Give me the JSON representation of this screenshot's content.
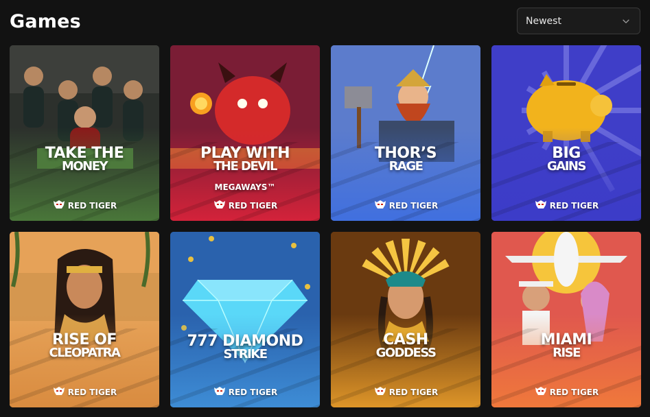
{
  "header": {
    "title": "Games",
    "sort": {
      "selected": "Newest"
    }
  },
  "games": [
    {
      "line1": "Take the",
      "line2": "Money",
      "line3": "",
      "provider": "RED TIGER",
      "bg_top": "#3a3f3a",
      "bg_bottom": "#4b7a3a",
      "accent": "#c9a67a",
      "icon": "gangsters-icon"
    },
    {
      "line1": "Play with",
      "line2": "the Devil",
      "line3": "Megaways™",
      "provider": "RED TIGER",
      "bg_top": "#6a1a2a",
      "bg_bottom": "#d8233a",
      "accent": "#e23a2a",
      "icon": "devil-icon"
    },
    {
      "line1": "Thor’s",
      "line2": "Rage",
      "line3": "",
      "provider": "RED TIGER",
      "bg_top": "#6f8fd0",
      "bg_bottom": "#3f6fe0",
      "accent": "#c44a24",
      "icon": "thor-icon"
    },
    {
      "line1": "Big",
      "line2": "Gains",
      "line3": "",
      "provider": "RED TIGER",
      "bg_top": "#4a47d6",
      "bg_bottom": "#3c3cc8",
      "accent": "#f2b31c",
      "icon": "piggy-bank-icon"
    },
    {
      "line1": "Rise of",
      "line2": "Cleopatra",
      "line3": "",
      "provider": "RED TIGER",
      "bg_top": "#e8a25a",
      "bg_bottom": "#d88a3e",
      "accent": "#5a3a22",
      "icon": "cleopatra-icon"
    },
    {
      "line1": "777 Diamond",
      "line2": "Strike",
      "line3": "",
      "provider": "RED TIGER",
      "bg_top": "#2a5aa0",
      "bg_bottom": "#3f8fd8",
      "accent": "#5ad8f8",
      "icon": "diamond-icon"
    },
    {
      "line1": "Cash",
      "line2": "Goddess",
      "line3": "",
      "provider": "RED TIGER",
      "bg_top": "#8a4a10",
      "bg_bottom": "#e49a2a",
      "accent": "#f5c542",
      "icon": "goddess-icon"
    },
    {
      "line1": "Miami",
      "line2": "Rise",
      "line3": "",
      "provider": "RED TIGER",
      "bg_top": "#d84a5a",
      "bg_bottom": "#f07a3a",
      "accent": "#f8d23a",
      "icon": "airplane-icon"
    }
  ]
}
